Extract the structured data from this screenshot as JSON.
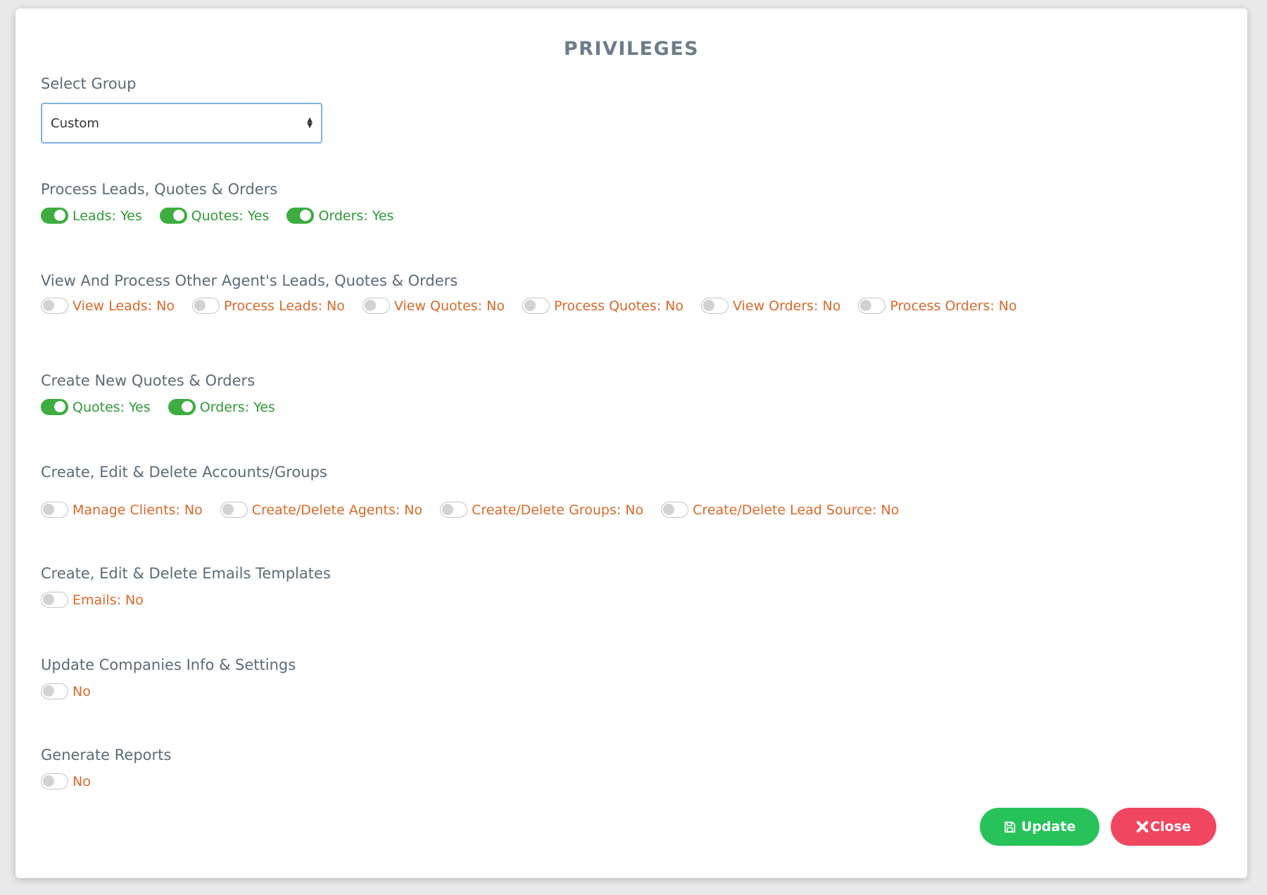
{
  "modal": {
    "title": "PRIVILEGES"
  },
  "group": {
    "label": "Select Group",
    "selected": "Custom"
  },
  "sections": [
    {
      "title": "Process Leads, Quotes & Orders",
      "toggles": [
        {
          "label": "Leads: Yes",
          "on": true
        },
        {
          "label": "Quotes: Yes",
          "on": true
        },
        {
          "label": "Orders: Yes",
          "on": true
        }
      ]
    },
    {
      "title": "View And Process Other Agent's Leads, Quotes & Orders",
      "toggles": [
        {
          "label": "View Leads: No",
          "on": false
        },
        {
          "label": "Process Leads: No",
          "on": false
        },
        {
          "label": "View Quotes: No",
          "on": false
        },
        {
          "label": "Process Quotes: No",
          "on": false
        },
        {
          "label": "View Orders: No",
          "on": false
        },
        {
          "label": "Process Orders: No",
          "on": false
        }
      ]
    },
    {
      "title": "Create New Quotes & Orders",
      "toggles": [
        {
          "label": "Quotes: Yes",
          "on": true
        },
        {
          "label": "Orders: Yes",
          "on": true
        }
      ]
    },
    {
      "title": "Create, Edit & Delete Accounts/Groups",
      "toggles": [
        {
          "label": "Manage Clients: No",
          "on": false
        },
        {
          "label": "Create/Delete Agents: No",
          "on": false
        },
        {
          "label": "Create/Delete Groups: No",
          "on": false
        },
        {
          "label": "Create/Delete Lead Source: No",
          "on": false
        }
      ]
    },
    {
      "title": "Create, Edit & Delete Emails Templates",
      "toggles": [
        {
          "label": "Emails: No",
          "on": false
        }
      ]
    },
    {
      "title": "Update Companies Info & Settings",
      "toggles": [
        {
          "label": "No",
          "on": false
        }
      ]
    },
    {
      "title": "Generate Reports",
      "toggles": [
        {
          "label": "No",
          "on": false
        }
      ]
    }
  ],
  "buttons": {
    "update": "Update",
    "close": "Close"
  },
  "colors": {
    "on": "#2e9a38",
    "off": "#d9692a",
    "update": "#27c35a",
    "close": "#f0465f"
  },
  "icons": {
    "update": "save-icon",
    "close": "close-icon",
    "select": "select-arrows-icon"
  }
}
